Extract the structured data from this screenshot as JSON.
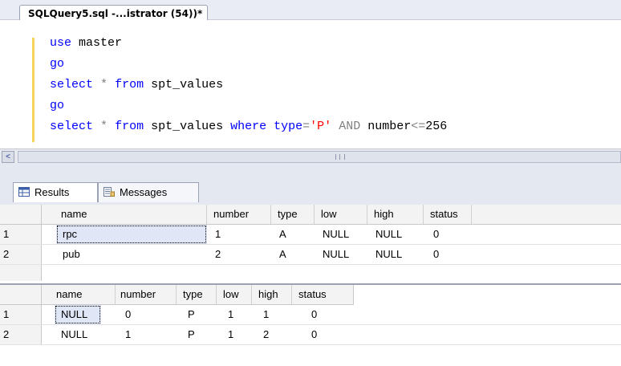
{
  "document_tab": {
    "title": "SQLQuery5.sql -...istrator (54))*"
  },
  "editor": {
    "lines": [
      {
        "tokens": [
          {
            "t": "use",
            "c": "kw"
          },
          {
            "t": " master",
            "c": ""
          }
        ]
      },
      {
        "tokens": [
          {
            "t": "go",
            "c": "kw"
          }
        ]
      },
      {
        "tokens": [
          {
            "t": "select",
            "c": "kw"
          },
          {
            "t": " ",
            "c": ""
          },
          {
            "t": "*",
            "c": "op"
          },
          {
            "t": " ",
            "c": ""
          },
          {
            "t": "from",
            "c": "kw"
          },
          {
            "t": " spt_values",
            "c": ""
          }
        ]
      },
      {
        "tokens": [
          {
            "t": "go",
            "c": "kw"
          }
        ]
      },
      {
        "tokens": [
          {
            "t": "select",
            "c": "kw"
          },
          {
            "t": " ",
            "c": ""
          },
          {
            "t": "*",
            "c": "op"
          },
          {
            "t": " ",
            "c": ""
          },
          {
            "t": "from",
            "c": "kw"
          },
          {
            "t": " spt_values ",
            "c": ""
          },
          {
            "t": "where",
            "c": "kw"
          },
          {
            "t": " ",
            "c": ""
          },
          {
            "t": "type",
            "c": "kw"
          },
          {
            "t": "=",
            "c": "op"
          },
          {
            "t": "'P'",
            "c": "str"
          },
          {
            "t": " ",
            "c": ""
          },
          {
            "t": "AND",
            "c": "dim"
          },
          {
            "t": " number",
            "c": ""
          },
          {
            "t": "<=",
            "c": "op"
          },
          {
            "t": "256",
            "c": ""
          }
        ]
      }
    ]
  },
  "scrollbar": {
    "left_arrow": "<",
    "grip": "III"
  },
  "results_tabs": {
    "results_label": "Results",
    "messages_label": "Messages"
  },
  "grid1": {
    "columns": [
      "name",
      "number",
      "type",
      "low",
      "high",
      "status"
    ],
    "rows": [
      {
        "num": "1",
        "cells": [
          "rpc",
          "1",
          "A",
          "NULL",
          "NULL",
          "0"
        ]
      },
      {
        "num": "2",
        "cells": [
          "pub",
          "2",
          "A",
          "NULL",
          "NULL",
          "0"
        ]
      }
    ]
  },
  "grid2": {
    "columns": [
      "name",
      "number",
      "type",
      "low",
      "high",
      "status"
    ],
    "rows": [
      {
        "num": "1",
        "cells": [
          "NULL",
          "0",
          "P",
          "1",
          "1",
          "0"
        ]
      },
      {
        "num": "2",
        "cells": [
          "NULL",
          "1",
          "P",
          "1",
          "2",
          "0"
        ]
      }
    ]
  },
  "colors": {
    "keyword": "#0000ff",
    "string": "#ff0000",
    "operator": "#808080",
    "selection": "#dfe6f6"
  }
}
